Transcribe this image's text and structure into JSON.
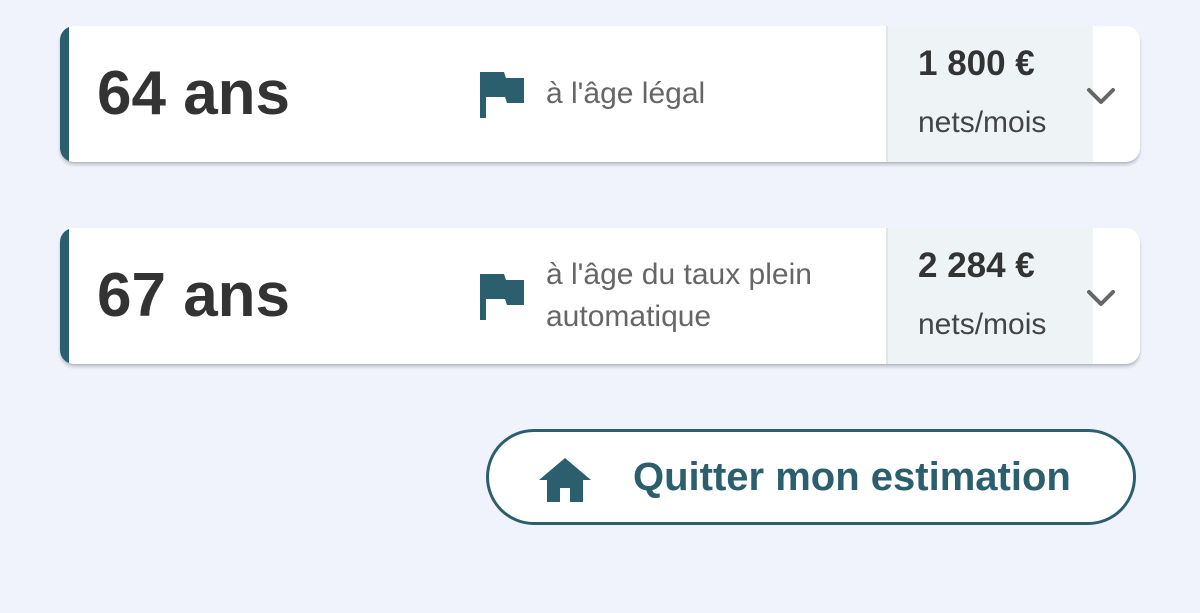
{
  "colors": {
    "page_background": "#f0f2fc",
    "accent": "#2b5f6e",
    "card_background": "#ffffff",
    "amount_background": "#eef3f5",
    "primary_text": "#333333",
    "secondary_text": "#666666"
  },
  "options": [
    {
      "age": "64 ans",
      "icon": "flag-icon",
      "description": "à l'âge légal",
      "amount": "1 800 €",
      "unit": "nets/mois",
      "chevron": "chevron-down-icon"
    },
    {
      "age": "67 ans",
      "icon": "flag-icon",
      "description": "à l'âge du taux plein\nautomatique",
      "amount": "2 284 €",
      "unit": "nets/mois",
      "chevron": "chevron-down-icon"
    }
  ],
  "quit_button": {
    "icon": "home-icon",
    "label": "Quitter mon estimation"
  }
}
